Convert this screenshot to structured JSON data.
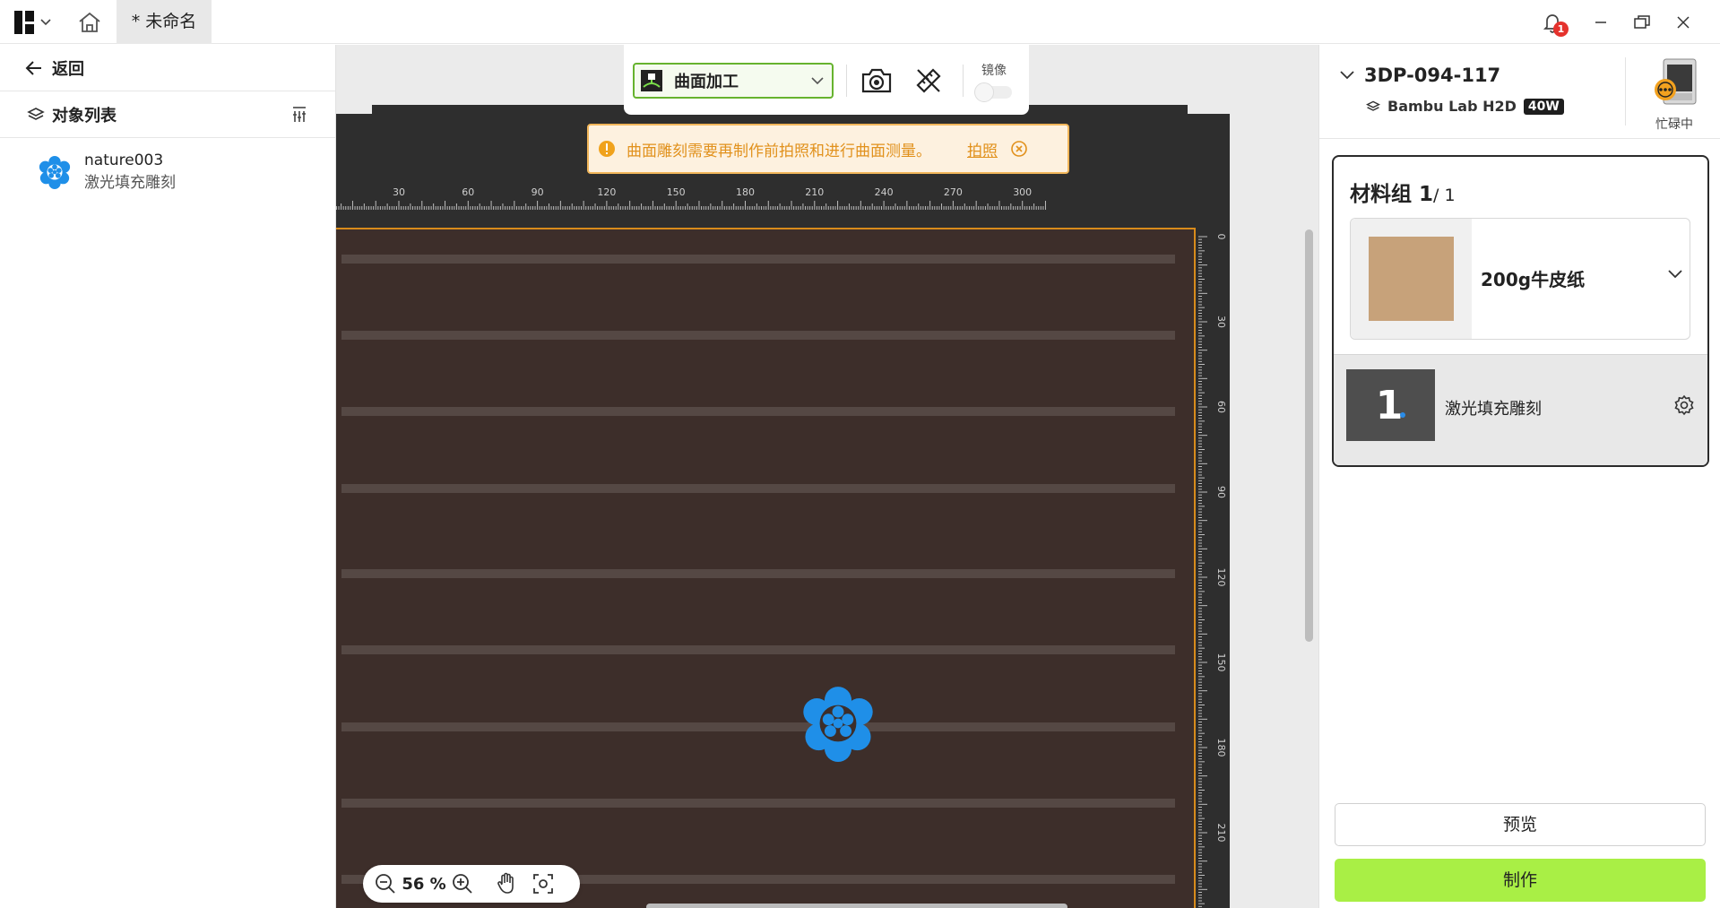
{
  "titlebar": {
    "tab_title": "* 未命名",
    "notification_count": "1"
  },
  "left_panel": {
    "back_label": "返回",
    "object_list_title": "对象列表",
    "objects": [
      {
        "name": "nature003",
        "process": "激光填充雕刻",
        "icon": "flower-icon"
      }
    ]
  },
  "canvas": {
    "toolbar": {
      "mode_label": "曲面加工",
      "mirror_label": "镜像",
      "mirror_on": false
    },
    "notice": {
      "message": "曲面雕刻需要再制作前拍照和进行曲面测量。",
      "action_label": "拍照"
    },
    "ruler_top_labels": [
      "30",
      "60",
      "90",
      "120",
      "150",
      "180",
      "210",
      "240",
      "270",
      "300"
    ],
    "ruler_right_labels": [
      "0",
      "30",
      "60",
      "90",
      "120",
      "150",
      "180",
      "210"
    ],
    "zoom": {
      "value": "56 %"
    },
    "colors": {
      "workarea": "#3d2e2a",
      "border": "#d88b1b",
      "object": "#1f8fe8"
    }
  },
  "right_panel": {
    "device": {
      "name": "3DP-094-117",
      "model": "Bambu Lab H2D",
      "power": "40W",
      "status": "忙碌中"
    },
    "material_group": {
      "title": "材料组 1",
      "count": "/ 1",
      "material_name": "200g牛皮纸",
      "layer_number": "1",
      "layer_name": "激光填充雕刻"
    },
    "preview_label": "预览",
    "make_label": "制作",
    "colors": {
      "accent": "#a9ef45"
    }
  }
}
